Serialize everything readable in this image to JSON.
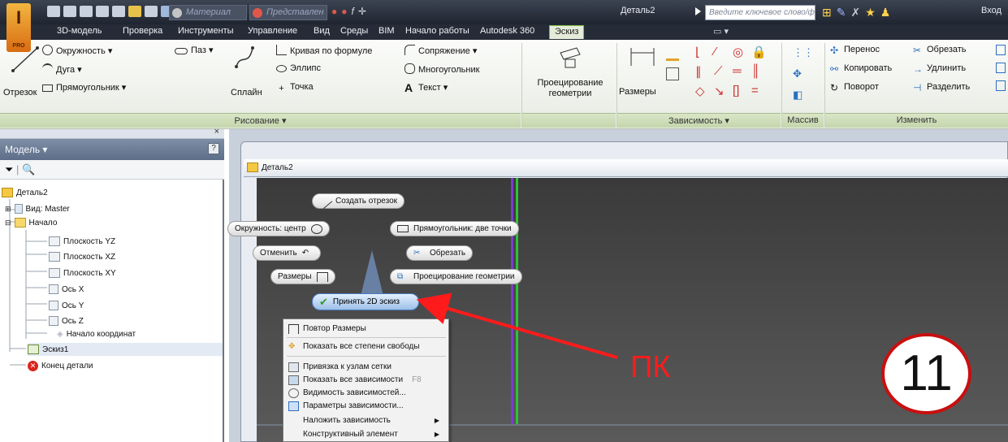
{
  "app": {
    "logo_letter": "I",
    "logo_sub": "PRO",
    "material_placeholder": "Материал",
    "appearance_placeholder": "Представлен",
    "document_title": "Деталь2",
    "keyword_search_placeholder": "Введите ключевое слово/фразу",
    "login_label": "Вход"
  },
  "tabs": [
    {
      "label": "3D-модель"
    },
    {
      "label": "Проверка"
    },
    {
      "label": "Инструменты"
    },
    {
      "label": "Управление"
    },
    {
      "label": "Вид"
    },
    {
      "label": "Среды"
    },
    {
      "label": "BIM"
    },
    {
      "label": "Начало работы"
    },
    {
      "label": "Autodesk 360"
    },
    {
      "label": "Эскиз"
    }
  ],
  "ribbon": {
    "draw": {
      "line": "Отрезок",
      "circle": "Окружность",
      "arc": "Дуга",
      "rectangle": "Прямоугольник",
      "slot": "Паз",
      "spline": "Сплайн",
      "formula_curve": "Кривая по формуле",
      "ellipse": "Эллипс",
      "point": "Точка",
      "fillet": "Сопряжение",
      "polygon": "Многоугольник",
      "text": "Текст",
      "footer": "Рисование"
    },
    "project": {
      "label_line1": "Проецирование",
      "label_line2": "геометрии"
    },
    "constrain": {
      "dimension": "Размеры",
      "footer": "Зависимость"
    },
    "pattern": {
      "footer": "Массив"
    },
    "modify": {
      "move": "Перенос",
      "copy": "Копировать",
      "rotate": "Поворот",
      "trim": "Обрезать",
      "extend": "Удлинить",
      "split": "Разделить",
      "footer": "Изменить"
    }
  },
  "browser": {
    "title": "Модель",
    "help": "?",
    "close": "×",
    "tree": [
      {
        "label": "Деталь2"
      },
      {
        "label": "Вид: Master"
      },
      {
        "label": "Начало"
      },
      {
        "label": "Плоскость YZ"
      },
      {
        "label": "Плоскость XZ"
      },
      {
        "label": "Плоскость XY"
      },
      {
        "label": "Ось X"
      },
      {
        "label": "Ось Y"
      },
      {
        "label": "Ось Z"
      },
      {
        "label": "Начало координат"
      },
      {
        "label": "Эскиз1"
      },
      {
        "label": "Конец детали"
      }
    ]
  },
  "document": {
    "tab_title": "Деталь2"
  },
  "marking_menu": {
    "create_line": "Создать отрезок",
    "circle_center": "Окружность: центр",
    "rect_two_points": "Прямоугольник: две точки",
    "undo": "Отменить",
    "trim": "Обрезать",
    "dimensions": "Размеры",
    "project_geometry": "Проецирование геометрии",
    "accept_sketch": "Принять 2D эскиз"
  },
  "context_menu": {
    "items": [
      {
        "label": "Повтор Размеры",
        "shortcut": ""
      },
      {
        "label": "Показать все степени свободы",
        "shortcut": ""
      },
      {
        "label": "Привязка к узлам сетки",
        "shortcut": ""
      },
      {
        "label": "Показать все зависимости",
        "shortcut": "F8"
      },
      {
        "label": "Видимость зависимостей...",
        "shortcut": ""
      },
      {
        "label": "Параметры зависимости...",
        "shortcut": ""
      },
      {
        "label": "Наложить зависимость",
        "shortcut": ""
      },
      {
        "label": "Конструктивный элемент",
        "shortcut": ""
      }
    ]
  },
  "annotation": {
    "label": "ПК",
    "step_number": "11",
    "color": "#ff1b1b"
  }
}
